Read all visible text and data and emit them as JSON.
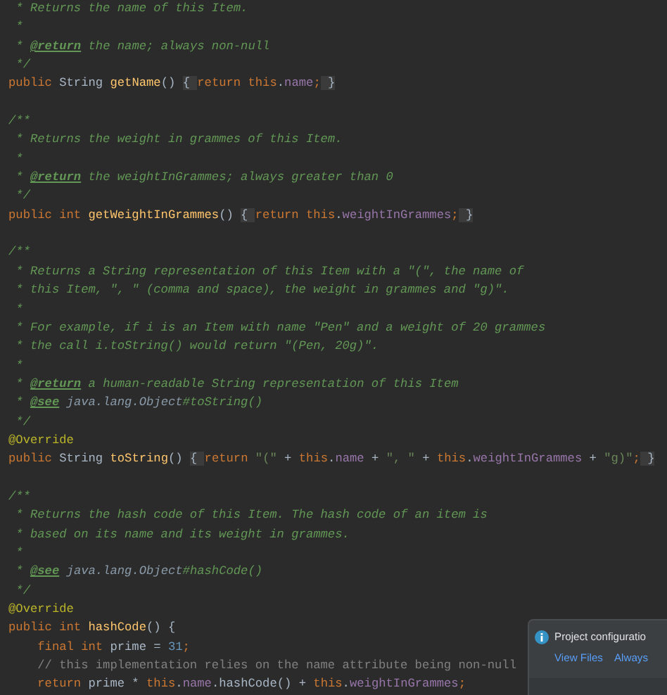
{
  "editor": {
    "lines": [
      {
        "kind": "code",
        "tokens": [
          {
            "kind": "comment",
            "text": " * Returns the name of this Item."
          }
        ]
      },
      {
        "kind": "code",
        "tokens": [
          {
            "kind": "comment",
            "text": " *"
          }
        ]
      },
      {
        "kind": "code",
        "tokens": [
          {
            "kind": "comment",
            "text": " * "
          },
          {
            "kind": "tag",
            "text": "@return"
          },
          {
            "kind": "comment",
            "text": " the name; always non-null"
          }
        ]
      },
      {
        "kind": "code",
        "tokens": [
          {
            "kind": "comment",
            "text": " */"
          }
        ]
      },
      {
        "kind": "code",
        "tokens": [
          {
            "kind": "keyword",
            "text": "public "
          },
          {
            "kind": "plain",
            "text": "String "
          },
          {
            "kind": "method",
            "text": "getName"
          },
          {
            "kind": "plain",
            "text": "() "
          },
          {
            "kind": "fold",
            "text": "{ "
          },
          {
            "kind": "keyword",
            "text": "return this"
          },
          {
            "kind": "plain",
            "text": "."
          },
          {
            "kind": "field",
            "text": "name"
          },
          {
            "kind": "keyword",
            "text": ";"
          },
          {
            "kind": "fold",
            "text": " }"
          }
        ]
      },
      {
        "kind": "blank"
      },
      {
        "kind": "code",
        "tokens": [
          {
            "kind": "comment",
            "text": "/**"
          }
        ]
      },
      {
        "kind": "code",
        "tokens": [
          {
            "kind": "comment",
            "text": " * Returns the weight in grammes of this Item."
          }
        ]
      },
      {
        "kind": "code",
        "tokens": [
          {
            "kind": "comment",
            "text": " *"
          }
        ]
      },
      {
        "kind": "code",
        "tokens": [
          {
            "kind": "comment",
            "text": " * "
          },
          {
            "kind": "tag",
            "text": "@return"
          },
          {
            "kind": "comment",
            "text": " the weightInGrammes; always greater than 0"
          }
        ]
      },
      {
        "kind": "code",
        "tokens": [
          {
            "kind": "comment",
            "text": " */"
          }
        ]
      },
      {
        "kind": "code",
        "tokens": [
          {
            "kind": "keyword",
            "text": "public int "
          },
          {
            "kind": "method",
            "text": "getWeightInGrammes"
          },
          {
            "kind": "plain",
            "text": "() "
          },
          {
            "kind": "fold",
            "text": "{ "
          },
          {
            "kind": "keyword",
            "text": "return this"
          },
          {
            "kind": "plain",
            "text": "."
          },
          {
            "kind": "field",
            "text": "weightInGrammes"
          },
          {
            "kind": "keyword",
            "text": ";"
          },
          {
            "kind": "fold",
            "text": " }"
          }
        ]
      },
      {
        "kind": "blank"
      },
      {
        "kind": "code",
        "tokens": [
          {
            "kind": "comment",
            "text": "/**"
          }
        ]
      },
      {
        "kind": "code",
        "tokens": [
          {
            "kind": "comment",
            "text": " * Returns a String representation of this Item with a \"(\", the name of"
          }
        ]
      },
      {
        "kind": "code",
        "tokens": [
          {
            "kind": "comment",
            "text": " * this Item, \", \" (comma and space), the weight in grammes and \"g)\"."
          }
        ]
      },
      {
        "kind": "code",
        "tokens": [
          {
            "kind": "comment",
            "text": " *"
          }
        ]
      },
      {
        "kind": "code",
        "tokens": [
          {
            "kind": "comment",
            "text": " * For example, if i is an Item with name \"Pen\" and a weight of 20 grammes"
          }
        ]
      },
      {
        "kind": "code",
        "tokens": [
          {
            "kind": "comment",
            "text": " * the call i.toString() would return \"(Pen, 20g)\"."
          }
        ]
      },
      {
        "kind": "code",
        "tokens": [
          {
            "kind": "comment",
            "text": " *"
          }
        ]
      },
      {
        "kind": "code",
        "tokens": [
          {
            "kind": "comment",
            "text": " * "
          },
          {
            "kind": "tag",
            "text": "@return"
          },
          {
            "kind": "comment",
            "text": " a human-readable String representation of this Item"
          }
        ]
      },
      {
        "kind": "code",
        "tokens": [
          {
            "kind": "comment",
            "text": " * "
          },
          {
            "kind": "tag",
            "text": "@see"
          },
          {
            "kind": "reference",
            "text": " java.lang.Object"
          },
          {
            "kind": "comment",
            "text": "#toString()"
          }
        ]
      },
      {
        "kind": "code",
        "tokens": [
          {
            "kind": "comment",
            "text": " */"
          }
        ]
      },
      {
        "kind": "code",
        "tokens": [
          {
            "kind": "annotation",
            "text": "@Override"
          }
        ]
      },
      {
        "kind": "code",
        "tokens": [
          {
            "kind": "keyword",
            "text": "public "
          },
          {
            "kind": "plain",
            "text": "String "
          },
          {
            "kind": "method",
            "text": "toString"
          },
          {
            "kind": "plain",
            "text": "() "
          },
          {
            "kind": "fold",
            "text": "{ "
          },
          {
            "kind": "keyword",
            "text": "return "
          },
          {
            "kind": "string",
            "text": "\"(\""
          },
          {
            "kind": "plain",
            "text": " + "
          },
          {
            "kind": "keyword",
            "text": "this"
          },
          {
            "kind": "plain",
            "text": "."
          },
          {
            "kind": "field",
            "text": "name"
          },
          {
            "kind": "plain",
            "text": " + "
          },
          {
            "kind": "string",
            "text": "\", \""
          },
          {
            "kind": "plain",
            "text": " + "
          },
          {
            "kind": "keyword",
            "text": "this"
          },
          {
            "kind": "plain",
            "text": "."
          },
          {
            "kind": "field",
            "text": "weightInGrammes"
          },
          {
            "kind": "plain",
            "text": " + "
          },
          {
            "kind": "string",
            "text": "\"g)\""
          },
          {
            "kind": "keyword",
            "text": ";"
          },
          {
            "kind": "fold",
            "text": " }"
          }
        ]
      },
      {
        "kind": "blank"
      },
      {
        "kind": "code",
        "tokens": [
          {
            "kind": "comment",
            "text": "/**"
          }
        ]
      },
      {
        "kind": "code",
        "tokens": [
          {
            "kind": "comment",
            "text": " * Returns the hash code of this Item. The hash code of an item is"
          }
        ]
      },
      {
        "kind": "code",
        "tokens": [
          {
            "kind": "comment",
            "text": " * based on its name and its weight in grammes."
          }
        ]
      },
      {
        "kind": "code",
        "tokens": [
          {
            "kind": "comment",
            "text": " *"
          }
        ]
      },
      {
        "kind": "code",
        "tokens": [
          {
            "kind": "comment",
            "text": " * "
          },
          {
            "kind": "tag",
            "text": "@see"
          },
          {
            "kind": "reference",
            "text": " java.lang.Object"
          },
          {
            "kind": "comment",
            "text": "#hashCode()"
          }
        ]
      },
      {
        "kind": "code",
        "tokens": [
          {
            "kind": "comment",
            "text": " */"
          }
        ]
      },
      {
        "kind": "code",
        "tokens": [
          {
            "kind": "annotation",
            "text": "@Override"
          }
        ]
      },
      {
        "kind": "code",
        "tokens": [
          {
            "kind": "keyword",
            "text": "public int "
          },
          {
            "kind": "method",
            "text": "hashCode"
          },
          {
            "kind": "plain",
            "text": "() {"
          }
        ]
      },
      {
        "kind": "code",
        "tokens": [
          {
            "kind": "keyword",
            "text": "    final int "
          },
          {
            "kind": "plain",
            "text": "prime = "
          },
          {
            "kind": "number",
            "text": "31"
          },
          {
            "kind": "keyword",
            "text": ";"
          }
        ]
      },
      {
        "kind": "code",
        "tokens": [
          {
            "kind": "linecomment",
            "text": "    // this implementation relies on the name attribute being non-null"
          }
        ]
      },
      {
        "kind": "code",
        "tokens": [
          {
            "kind": "keyword",
            "text": "    return "
          },
          {
            "kind": "plain",
            "text": "prime * "
          },
          {
            "kind": "keyword",
            "text": "this"
          },
          {
            "kind": "plain",
            "text": "."
          },
          {
            "kind": "field",
            "text": "name"
          },
          {
            "kind": "plain",
            "text": ".hashCode() + "
          },
          {
            "kind": "keyword",
            "text": "this"
          },
          {
            "kind": "plain",
            "text": "."
          },
          {
            "kind": "field",
            "text": "weightInGrammes"
          },
          {
            "kind": "keyword",
            "text": ";"
          }
        ]
      }
    ]
  },
  "notification": {
    "text": "Project configuratio",
    "actions": [
      "View Files",
      "Always"
    ]
  }
}
